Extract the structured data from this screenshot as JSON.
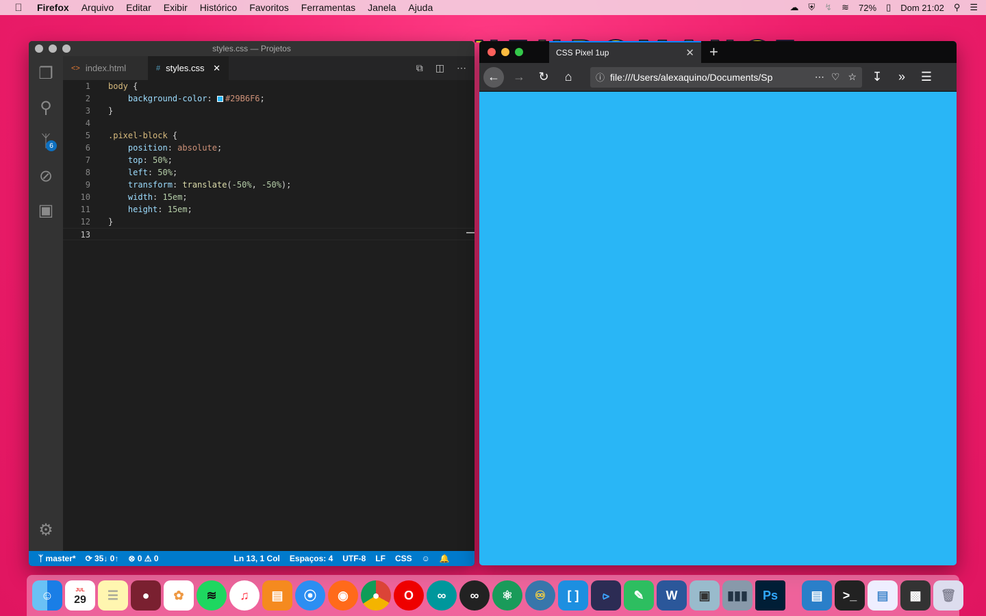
{
  "menubar": {
    "app": "Firefox",
    "items": [
      "Arquivo",
      "Editar",
      "Exibir",
      "Histórico",
      "Favoritos",
      "Ferramentas",
      "Janela",
      "Ajuda"
    ],
    "battery": "72%",
    "clock": "Dom 21:02"
  },
  "wallpaper_title": "NEUROMANCER",
  "vscode": {
    "window_title": "styles.css — Projetos",
    "tabs": [
      {
        "label": "index.html",
        "icon": "<>"
      },
      {
        "label": "styles.css",
        "icon": "#"
      }
    ],
    "scm_badge": "6",
    "lines": [
      "1",
      "2",
      "3",
      "4",
      "5",
      "6",
      "7",
      "8",
      "9",
      "10",
      "11",
      "12",
      "13"
    ],
    "code": {
      "l1_sel": "body",
      "l2_prop": "background-color",
      "l2_val": "#29B6F6",
      "l5_sel": ".pixel-block",
      "l6_prop": "position",
      "l6_val": "absolute",
      "l7_prop": "top",
      "l7_val": "50%",
      "l8_prop": "left",
      "l8_val": "50%",
      "l9_prop": "transform",
      "l9_fn": "translate",
      "l9_a": "-50%",
      "l9_b": "-50%",
      "l10_prop": "width",
      "l10_val": "15em",
      "l11_prop": "height",
      "l11_val": "15em"
    },
    "status": {
      "branch": "master*",
      "sync": "35↓ 0↑",
      "errors": "0",
      "warnings": "0",
      "position": "Ln 13, 1 Col",
      "spaces": "Espaços: 4",
      "encoding": "UTF-8",
      "eol": "LF",
      "language": "CSS"
    }
  },
  "firefox": {
    "tab_title": "CSS Pixel 1up",
    "url": "file:///Users/alexaquino/Documents/Sp",
    "page_background": "#29B6F6"
  },
  "dock": {
    "calendar_month": "JUL",
    "calendar_day": "29",
    "icons": [
      "finder-icon",
      "calendar-icon",
      "notes-icon",
      "joystick-icon",
      "photos-icon",
      "spotify-icon",
      "itunes-icon",
      "ibooks-icon",
      "safari-icon",
      "firefox-icon",
      "chrome-icon",
      "opera-icon",
      "arduino-icon",
      "arduino-ide-icon",
      "atom-icon",
      "python-icon",
      "brackets-icon",
      "vscode-icon",
      "evernote-icon",
      "word-icon",
      "preview-icon",
      "columns-icon",
      "photoshop-icon",
      "folder-icon",
      "terminal-icon",
      "window-icon",
      "screenshot-icon",
      "trash-icon"
    ]
  }
}
